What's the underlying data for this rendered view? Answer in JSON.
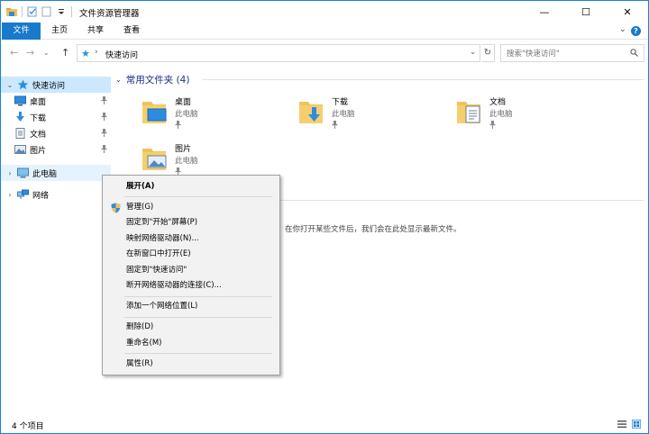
{
  "window": {
    "title": "文件资源管理器",
    "controls": {
      "minimize": "—",
      "maximize": "☐",
      "close": "✕"
    }
  },
  "ribbon": {
    "tabs": [
      {
        "label": "文件",
        "active": true
      },
      {
        "label": "主页"
      },
      {
        "label": "共享"
      },
      {
        "label": "查看"
      }
    ],
    "collapse": "⌄",
    "help": "?"
  },
  "address": {
    "back": "←",
    "forward": "→",
    "recent": "⌄",
    "up": "↑",
    "crumb_sep": "›",
    "path": "快速访问",
    "dropdown": "⌄",
    "refresh": "↻",
    "search_placeholder": "搜索\"快速访问\""
  },
  "nav": {
    "quick_access": "快速访问",
    "quick_items": [
      {
        "label": "桌面",
        "icon": "desktop-icon"
      },
      {
        "label": "下载",
        "icon": "download-icon"
      },
      {
        "label": "文档",
        "icon": "documents-icon"
      },
      {
        "label": "图片",
        "icon": "pictures-icon"
      }
    ],
    "this_pc": "此电脑",
    "network": "网络",
    "expand_open": "⌄",
    "expand_closed": "›"
  },
  "content": {
    "group_title": "常用文件夹 (4)",
    "folders": [
      {
        "name": "桌面",
        "location": "此电脑"
      },
      {
        "name": "下载",
        "location": "此电脑"
      },
      {
        "name": "文档",
        "location": "此电脑"
      },
      {
        "name": "图片",
        "location": "此电脑"
      }
    ],
    "empty_message": "在你打开某些文件后，我们会在此处显示最新文件。"
  },
  "status": {
    "item_count": "4 个项目"
  },
  "context_menu": {
    "items": [
      {
        "label": "展开(A)",
        "bold": true
      },
      {
        "label": "管理(G)",
        "icon": "shield-icon"
      },
      {
        "label": "固定到\"开始\"屏幕(P)"
      },
      {
        "label": "映射网络驱动器(N)..."
      },
      {
        "label": "在新窗口中打开(E)"
      },
      {
        "label": "固定到\"快速访问\""
      },
      {
        "label": "断开网络驱动器的连接(C)..."
      },
      {
        "label": "添加一个网络位置(L)"
      },
      {
        "label": "删除(D)"
      },
      {
        "label": "重命名(M)"
      },
      {
        "label": "属性(R)"
      }
    ]
  },
  "colors": {
    "accent": "#1979ca",
    "selection": "#cce8ff",
    "hover": "#e5f3ff",
    "folder": "#f0c35a",
    "group_header": "#1e3287"
  }
}
